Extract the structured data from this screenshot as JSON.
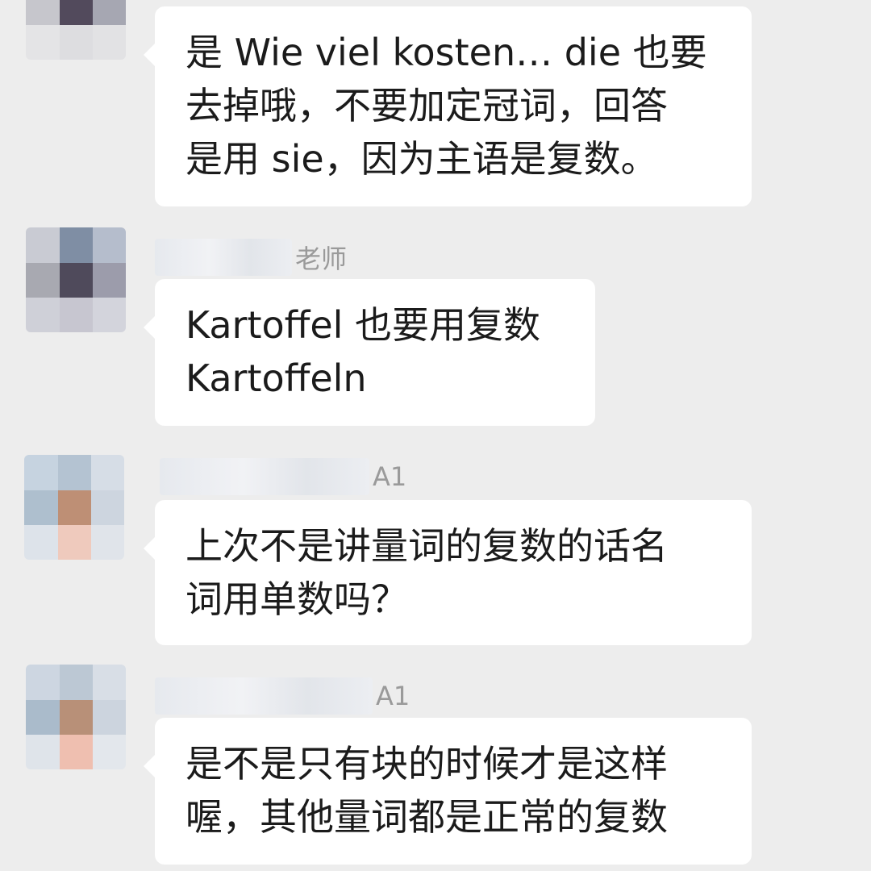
{
  "messages": [
    {
      "sender_visible": "",
      "lines": [
        "是 Wie viel kosten… die 也要",
        "去掉哦，不要加定冠词，回答",
        "是用 sie，因为主语是复数。"
      ]
    },
    {
      "sender_visible": "老师",
      "lines": [
        "Kartoffel 也要用复数",
        "Kartoffeln"
      ]
    },
    {
      "sender_visible": "A1",
      "lines": [
        "上次不是讲量词的复数的话名",
        "词用单数吗？"
      ]
    },
    {
      "sender_visible": "A1",
      "lines": [
        "是不是只有块的时候才是这样",
        "喔，其他量词都是正常的复数"
      ]
    }
  ]
}
